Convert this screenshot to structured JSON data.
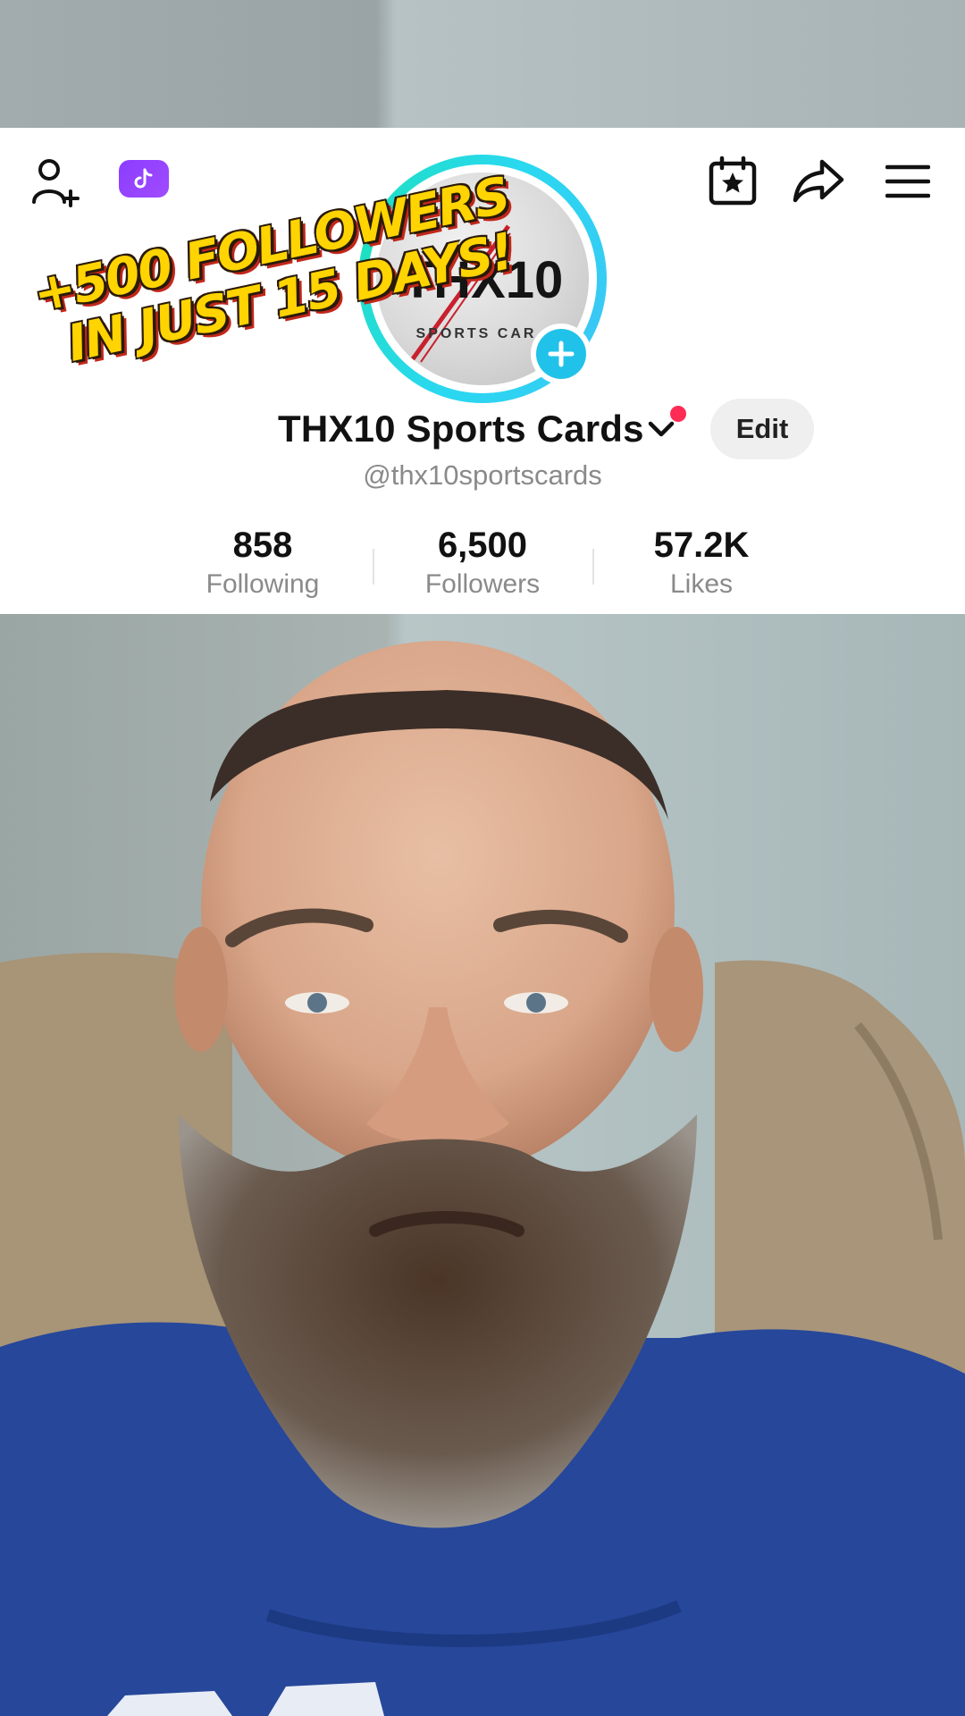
{
  "overlay": {
    "line1": "+500 FOLLOWERS",
    "line2": "IN JUST 15 DAYS!"
  },
  "header": {
    "icons": [
      "add-friend-icon",
      "tiktok-badge-icon",
      "calendar-star-icon",
      "share-icon",
      "menu-icon"
    ]
  },
  "avatar": {
    "logo_text": "THX10",
    "logo_subtext": "SPORTS CAR"
  },
  "profile": {
    "display_name": "THX10 Sports Cards",
    "username": "@thx10sportscards",
    "edit_label": "Edit"
  },
  "stats": [
    {
      "value": "858",
      "label": "Following"
    },
    {
      "value": "6,500",
      "label": "Followers"
    },
    {
      "value": "57.2K",
      "label": "Likes"
    }
  ],
  "colors": {
    "accent": "#fe2c55",
    "ring": "#2ad8f0",
    "overlay_text": "#ffd400"
  }
}
